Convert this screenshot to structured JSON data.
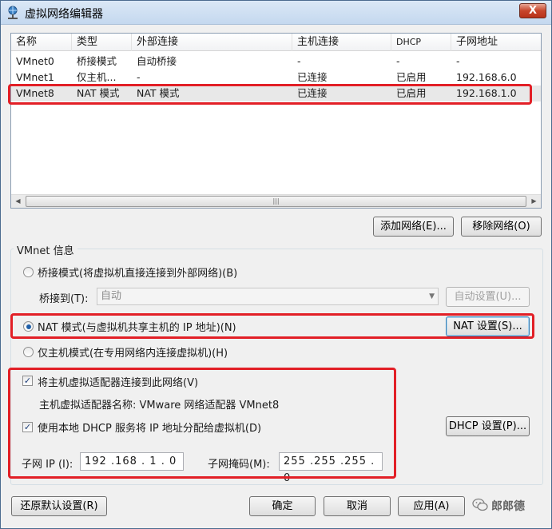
{
  "window": {
    "title": "虚拟网络编辑器",
    "close_label": "X"
  },
  "table": {
    "columns": [
      "名称",
      "类型",
      "外部连接",
      "主机连接",
      "DHCP",
      "子网地址"
    ],
    "rows": [
      [
        "VMnet0",
        "桥接模式",
        "自动桥接",
        "-",
        "-",
        "-"
      ],
      [
        "VMnet1",
        "仅主机...",
        "-",
        "已连接",
        "已启用",
        "192.168.6.0"
      ],
      [
        "VMnet8",
        "NAT 模式",
        "NAT 模式",
        "已连接",
        "已启用",
        "192.168.1.0"
      ]
    ],
    "selected_row": "VMnet8"
  },
  "buttons": {
    "add_network": "添加网络(E)...",
    "remove_network": "移除网络(O)",
    "auto_settings": "自动设置(U)...",
    "nat_settings": "NAT 设置(S)...",
    "dhcp_settings": "DHCP 设置(P)...",
    "restore_defaults": "还原默认设置(R)",
    "ok": "确定",
    "cancel": "取消",
    "apply": "应用(A)"
  },
  "vmnet_info": {
    "group_title": "VMnet 信息",
    "bridged_label": "桥接模式(将虚拟机直接连接到外部网络)(B)",
    "bridge_to_label": "桥接到(T):",
    "bridge_to_value": "自动",
    "nat_label": "NAT 模式(与虚拟机共享主机的 IP 地址)(N)",
    "hostonly_label": "仅主机模式(在专用网络内连接虚拟机)(H)",
    "selected_mode": "nat",
    "connect_adapter_label": "将主机虚拟适配器连接到此网络(V)",
    "connect_adapter_checked": true,
    "adapter_name_label": "主机虚拟适配器名称: VMware 网络适配器 VMnet8",
    "use_dhcp_label": "使用本地 DHCP 服务将 IP 地址分配给虚拟机(D)",
    "use_dhcp_checked": true,
    "subnet_ip_label": "子网 IP (I):",
    "subnet_ip_value": "192 .168 . 1 . 0",
    "subnet_mask_label": "子网掩码(M):",
    "subnet_mask_value": "255 .255 .255 . 0"
  },
  "watermark": {
    "text": "郎郎德",
    "icon": "wechat-icon"
  },
  "colors": {
    "highlight_box": "#e21f26",
    "radio_dot": "#1f5fa8"
  }
}
